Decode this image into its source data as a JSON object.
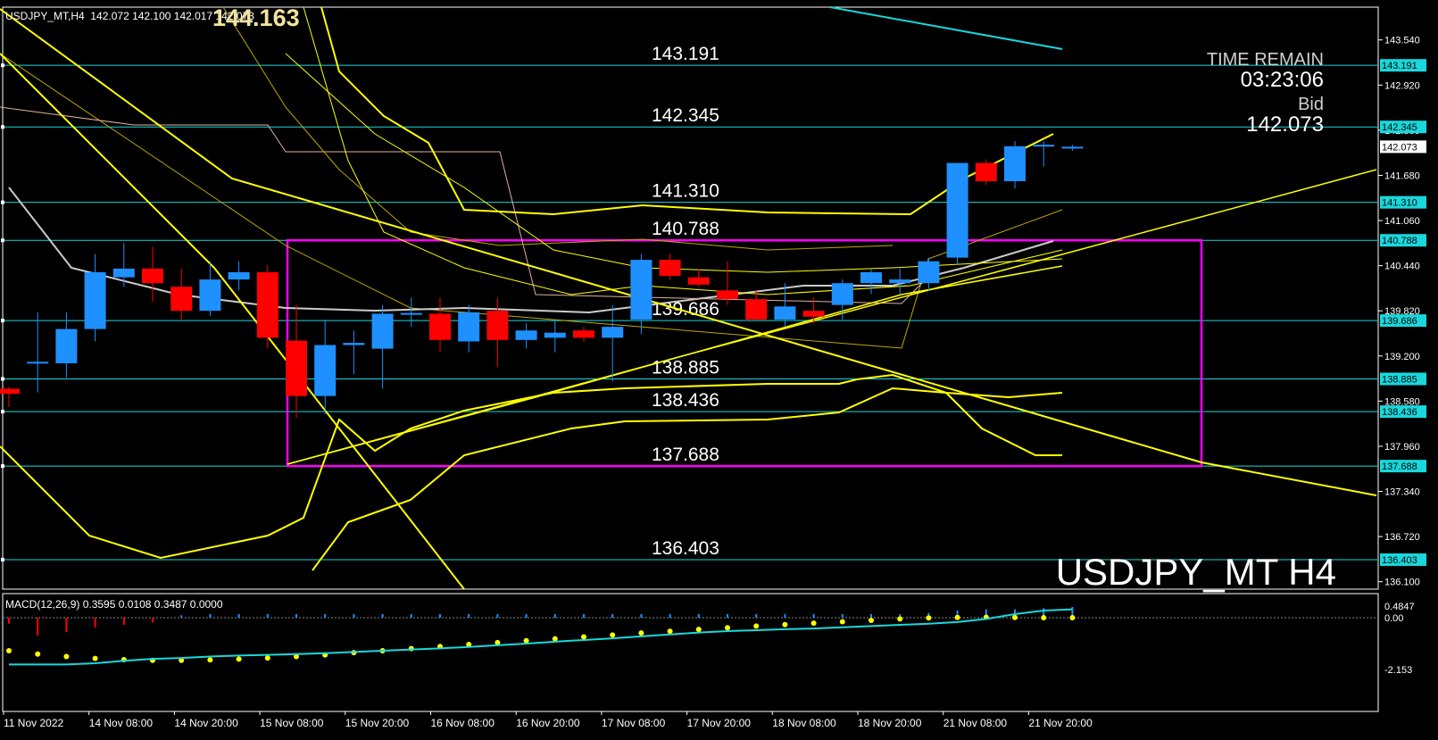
{
  "header": {
    "symbol_info": "USDJPY_MT,H4",
    "ohlc": "142.072 142.100 142.017 142.073",
    "big_price": "144.163"
  },
  "timer": {
    "label": "TIME REMAIN",
    "value": "03:23:06",
    "bid_label": "Bid",
    "bid_value": "142.073"
  },
  "symbol_watermark": "USDJPY_MT H4",
  "macd_header": "MACD(12,26,9) 0.3595 0.0108 0.3487 0.0000",
  "colors": {
    "background": "#000000",
    "level_line": "#18d8dc",
    "bull_candle": "#1e90ff",
    "bear_candle": "#ff0000",
    "range_box": "#ff00ff",
    "band": "#ffff00",
    "ma": "#f0f0f0",
    "macd_signal": "#ffff00",
    "macd_line": "#18d8dc"
  },
  "chart_data": [
    {
      "type": "candlestick",
      "title": "",
      "y_ticks": [
        "143.540",
        "142.920",
        "142.300",
        "141.680",
        "141.060",
        "140.440",
        "139.820",
        "139.200",
        "138.580",
        "137.960",
        "137.340",
        "136.720",
        "136.100"
      ],
      "ylim": [
        135.9,
        143.99
      ],
      "x_tick_labels": [
        "11 Nov 2022",
        "14 Nov 08:00",
        "14 Nov 20:00",
        "15 Nov 08:00",
        "15 Nov 20:00",
        "16 Nov 08:00",
        "16 Nov 20:00",
        "17 Nov 08:00",
        "17 Nov 20:00",
        "18 Nov 08:00",
        "18 Nov 20:00",
        "21 Nov 08:00",
        "21 Nov 20:00"
      ],
      "current_bid": 142.073,
      "levels": [
        {
          "value": 143.191,
          "label": "143.191"
        },
        {
          "value": 142.345,
          "label": "142.345"
        },
        {
          "value": 141.31,
          "label": "141.310"
        },
        {
          "value": 140.788,
          "label": "140.788"
        },
        {
          "value": 139.686,
          "label": "139.686"
        },
        {
          "value": 138.885,
          "label": "138.885"
        },
        {
          "value": 138.436,
          "label": "138.436"
        },
        {
          "value": 137.688,
          "label": "137.688"
        },
        {
          "value": 136.403,
          "label": "136.403"
        }
      ],
      "range_box": {
        "top": 140.788,
        "bottom": 137.688
      },
      "candles": [
        {
          "o": 138.75,
          "h": 138.78,
          "l": 138.5,
          "c": 138.68
        },
        {
          "o": 139.1,
          "h": 139.8,
          "l": 138.7,
          "c": 139.12
        },
        {
          "o": 139.1,
          "h": 139.8,
          "l": 138.9,
          "c": 139.57
        },
        {
          "o": 139.57,
          "h": 140.6,
          "l": 139.4,
          "c": 140.35
        },
        {
          "o": 140.28,
          "h": 140.75,
          "l": 140.15,
          "c": 140.4
        },
        {
          "o": 140.4,
          "h": 140.7,
          "l": 139.95,
          "c": 140.2
        },
        {
          "o": 140.15,
          "h": 140.4,
          "l": 139.7,
          "c": 139.82
        },
        {
          "o": 139.82,
          "h": 140.5,
          "l": 139.75,
          "c": 140.25
        },
        {
          "o": 140.25,
          "h": 140.5,
          "l": 140.1,
          "c": 140.35
        },
        {
          "o": 140.35,
          "h": 140.45,
          "l": 139.3,
          "c": 139.45
        },
        {
          "o": 139.41,
          "h": 139.9,
          "l": 138.35,
          "c": 138.65
        },
        {
          "o": 138.65,
          "h": 139.7,
          "l": 138.4,
          "c": 139.35
        },
        {
          "o": 139.35,
          "h": 139.55,
          "l": 138.95,
          "c": 139.38
        },
        {
          "o": 139.3,
          "h": 139.9,
          "l": 138.75,
          "c": 139.78
        },
        {
          "o": 139.78,
          "h": 140.0,
          "l": 139.6,
          "c": 139.79
        },
        {
          "o": 139.78,
          "h": 140.0,
          "l": 139.25,
          "c": 139.42
        },
        {
          "o": 139.4,
          "h": 139.9,
          "l": 139.25,
          "c": 139.8
        },
        {
          "o": 139.82,
          "h": 140.0,
          "l": 139.05,
          "c": 139.42
        },
        {
          "o": 139.42,
          "h": 139.65,
          "l": 139.3,
          "c": 139.55
        },
        {
          "o": 139.45,
          "h": 139.7,
          "l": 139.25,
          "c": 139.52
        },
        {
          "o": 139.55,
          "h": 139.6,
          "l": 139.4,
          "c": 139.45
        },
        {
          "o": 139.45,
          "h": 139.9,
          "l": 138.85,
          "c": 139.6
        },
        {
          "o": 139.7,
          "h": 140.6,
          "l": 139.5,
          "c": 140.52
        },
        {
          "o": 140.52,
          "h": 140.6,
          "l": 140.25,
          "c": 140.3
        },
        {
          "o": 140.28,
          "h": 140.4,
          "l": 140.15,
          "c": 140.18
        },
        {
          "o": 140.1,
          "h": 140.5,
          "l": 139.9,
          "c": 139.98
        },
        {
          "o": 139.98,
          "h": 140.1,
          "l": 139.7,
          "c": 139.7
        },
        {
          "o": 139.7,
          "h": 140.2,
          "l": 139.6,
          "c": 139.88
        },
        {
          "o": 139.82,
          "h": 140.0,
          "l": 139.65,
          "c": 139.74
        },
        {
          "o": 139.9,
          "h": 140.25,
          "l": 139.7,
          "c": 140.2
        },
        {
          "o": 140.2,
          "h": 140.4,
          "l": 140.05,
          "c": 140.35
        },
        {
          "o": 140.2,
          "h": 140.4,
          "l": 140.05,
          "c": 140.25
        },
        {
          "o": 140.2,
          "h": 140.55,
          "l": 140.1,
          "c": 140.5
        },
        {
          "o": 140.55,
          "h": 141.85,
          "l": 140.45,
          "c": 141.85
        },
        {
          "o": 141.85,
          "h": 141.9,
          "l": 141.55,
          "c": 141.6
        },
        {
          "o": 141.6,
          "h": 142.15,
          "l": 141.5,
          "c": 142.08
        },
        {
          "o": 142.08,
          "h": 142.15,
          "l": 141.8,
          "c": 142.1
        },
        {
          "o": 142.07,
          "h": 142.1,
          "l": 142.02,
          "c": 142.073
        }
      ]
    },
    {
      "type": "macd",
      "title": "MACD(12,26,9)",
      "y_ticks": [
        "0.4847",
        "0.00",
        "-2.153"
      ],
      "ylim": [
        -2.25,
        0.55
      ],
      "histogram": [
        -0.25,
        -0.75,
        -0.6,
        -0.4,
        -0.3,
        -0.2,
        0.1,
        0.15,
        0.15,
        0.15,
        0.15,
        0.15,
        0.15,
        0.15,
        0.15,
        0.15,
        0.15,
        0.15,
        0.15,
        0.15,
        0.15,
        0.15,
        0.15,
        0.15,
        0.15,
        0.15,
        0.15,
        0.15,
        0.15,
        0.15,
        0.15,
        0.15,
        0.2,
        0.3,
        0.35,
        0.35,
        0.4,
        0.45
      ],
      "signal": [
        -1.38,
        -1.52,
        -1.62,
        -1.7,
        -1.75,
        -1.78,
        -1.78,
        -1.76,
        -1.73,
        -1.68,
        -1.62,
        -1.55,
        -1.46,
        -1.38,
        -1.29,
        -1.2,
        -1.12,
        -1.04,
        -0.96,
        -0.88,
        -0.8,
        -0.72,
        -0.64,
        -0.57,
        -0.49,
        -0.42,
        -0.35,
        -0.29,
        -0.23,
        -0.17,
        -0.11,
        -0.05,
        -0.01,
        0.01,
        0.02,
        0.01,
        0.0,
        0.0
      ],
      "macd": [
        -1.95,
        -1.95,
        -1.95,
        -1.9,
        -1.8,
        -1.72,
        -1.68,
        -1.62,
        -1.58,
        -1.55,
        -1.52,
        -1.48,
        -1.43,
        -1.38,
        -1.33,
        -1.28,
        -1.22,
        -1.15,
        -1.08,
        -1.0,
        -0.93,
        -0.86,
        -0.78,
        -0.7,
        -0.62,
        -0.56,
        -0.52,
        -0.48,
        -0.45,
        -0.4,
        -0.35,
        -0.3,
        -0.25,
        -0.18,
        -0.05,
        0.15,
        0.3,
        0.35
      ]
    }
  ]
}
